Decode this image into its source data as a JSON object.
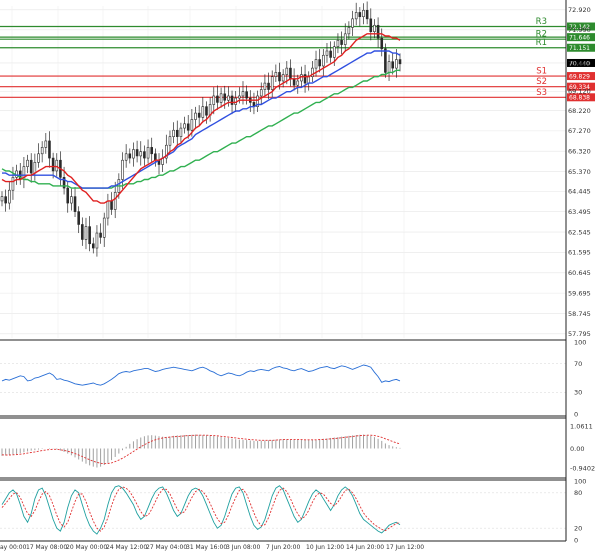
{
  "chart_data": [
    {
      "type": "candlestick",
      "ylim": [
        57.6,
        73.1
      ],
      "price_ticks": [
        "72.920",
        "71.990",
        "70.440",
        "69.120",
        "68.220",
        "67.270",
        "66.320",
        "65.370",
        "64.445",
        "63.495",
        "62.545",
        "61.595",
        "60.645",
        "59.695",
        "58.745",
        "57.795"
      ],
      "price_tick_values": [
        72.92,
        71.99,
        70.44,
        69.12,
        68.22,
        67.27,
        66.32,
        65.37,
        64.445,
        63.495,
        62.545,
        61.595,
        60.645,
        59.695,
        58.745,
        57.795
      ],
      "current_price": {
        "label": "70.440",
        "value": 70.44,
        "color": "#000000"
      },
      "levels": [
        {
          "name": "R3",
          "label": "72.142",
          "value": 72.142,
          "color": "#2e8b2e"
        },
        {
          "name": "",
          "label": "71.646",
          "value": 71.646,
          "color": "#2e8b2e"
        },
        {
          "name": "R2",
          "label": "",
          "value": 71.55,
          "color": "#2e8b2e"
        },
        {
          "name": "R1",
          "label": "71.151",
          "value": 71.151,
          "color": "#2e8b2e"
        },
        {
          "name": "S1",
          "label": "69.829",
          "value": 69.829,
          "color": "#e03030"
        },
        {
          "name": "S2",
          "label": "69.334",
          "value": 69.334,
          "color": "#e03030"
        },
        {
          "name": "S3",
          "label": "68.838",
          "value": 68.838,
          "color": "#e03030"
        }
      ],
      "ma_colors": {
        "fast": "#e02020",
        "mid": "#3050e0",
        "slow": "#30b050"
      },
      "candle_colors": {
        "body": "#2a2a2a",
        "wick": "#2a2a2a"
      },
      "grid": true,
      "closes": [
        64.2,
        63.9,
        64.5,
        65.1,
        65.4,
        65.0,
        65.6,
        65.9,
        65.3,
        65.8,
        66.2,
        66.5,
        66.8,
        66.0,
        65.4,
        65.9,
        65.1,
        64.6,
        63.9,
        64.2,
        63.5,
        62.9,
        62.2,
        62.8,
        62.0,
        61.8,
        62.5,
        62.3,
        63.2,
        64.0,
        63.6,
        64.4,
        65.0,
        65.9,
        66.2,
        66.0,
        66.4,
        66.1,
        66.3,
        66.0,
        66.5,
        66.2,
        65.9,
        65.7,
        66.0,
        66.6,
        67.0,
        67.3,
        67.0,
        67.4,
        67.6,
        67.3,
        67.8,
        68.1,
        67.9,
        68.4,
        68.0,
        68.5,
        68.9,
        68.6,
        69.0,
        68.7,
        68.9,
        68.5,
        68.8,
        68.9,
        69.1,
        68.8,
        68.6,
        68.4,
        68.9,
        69.2,
        69.5,
        69.2,
        69.8,
        70.0,
        69.6,
        69.9,
        70.2,
        69.7,
        69.4,
        69.6,
        69.9,
        69.5,
        69.8,
        70.2,
        70.6,
        70.3,
        70.8,
        71.0,
        70.7,
        71.2,
        71.5,
        71.3,
        71.8,
        72.1,
        72.5,
        72.8,
        72.6,
        72.9,
        72.5,
        71.9,
        72.2,
        71.6,
        71.1,
        70.0,
        70.5,
        70.2,
        70.6,
        70.4
      ],
      "ma_fast": [
        65.0,
        64.9,
        64.9,
        64.9,
        65.0,
        65.0,
        65.1,
        65.2,
        65.2,
        65.3,
        65.4,
        65.5,
        65.6,
        65.6,
        65.6,
        65.6,
        65.5,
        65.4,
        65.2,
        65.1,
        64.9,
        64.7,
        64.5,
        64.4,
        64.2,
        64.0,
        64.0,
        63.9,
        63.9,
        64.0,
        64.0,
        64.1,
        64.3,
        64.5,
        64.7,
        64.9,
        65.1,
        65.3,
        65.5,
        65.6,
        65.7,
        65.8,
        65.9,
        65.9,
        66.0,
        66.1,
        66.3,
        66.4,
        66.6,
        66.7,
        66.9,
        67.0,
        67.2,
        67.4,
        67.5,
        67.7,
        67.8,
        68.0,
        68.2,
        68.3,
        68.4,
        68.5,
        68.6,
        68.6,
        68.6,
        68.7,
        68.7,
        68.7,
        68.7,
        68.7,
        68.7,
        68.8,
        68.9,
        69.0,
        69.1,
        69.3,
        69.4,
        69.5,
        69.6,
        69.7,
        69.7,
        69.7,
        69.8,
        69.8,
        69.8,
        69.9,
        70.0,
        70.1,
        70.2,
        70.3,
        70.4,
        70.5,
        70.7,
        70.8,
        71.0,
        71.1,
        71.3,
        71.5,
        71.6,
        71.7,
        71.8,
        71.8,
        71.8,
        71.8,
        71.8,
        71.7,
        71.7,
        71.6,
        71.6,
        71.5
      ],
      "ma_mid": [
        65.3,
        65.3,
        65.2,
        65.2,
        65.2,
        65.2,
        65.2,
        65.2,
        65.2,
        65.2,
        65.2,
        65.2,
        65.2,
        65.2,
        65.2,
        65.1,
        65.0,
        65.0,
        64.9,
        64.9,
        64.8,
        64.7,
        64.6,
        64.6,
        64.6,
        64.6,
        64.6,
        64.6,
        64.6,
        64.6,
        64.7,
        64.7,
        64.8,
        64.9,
        65.0,
        65.1,
        65.2,
        65.3,
        65.4,
        65.5,
        65.6,
        65.7,
        65.8,
        65.9,
        66.0,
        66.1,
        66.2,
        66.3,
        66.5,
        66.6,
        66.7,
        66.8,
        66.9,
        67.1,
        67.2,
        67.3,
        67.4,
        67.5,
        67.6,
        67.7,
        67.8,
        67.9,
        68.0,
        68.1,
        68.2,
        68.2,
        68.3,
        68.3,
        68.4,
        68.4,
        68.5,
        68.5,
        68.6,
        68.7,
        68.8,
        68.8,
        68.9,
        69.0,
        69.1,
        69.1,
        69.2,
        69.3,
        69.3,
        69.4,
        69.5,
        69.5,
        69.6,
        69.7,
        69.8,
        69.8,
        69.9,
        70.0,
        70.1,
        70.2,
        70.3,
        70.4,
        70.5,
        70.6,
        70.7,
        70.8,
        70.9,
        70.9,
        71.0,
        71.0,
        71.0,
        71.0,
        71.0,
        70.9,
        70.9,
        70.8
      ],
      "ma_slow": [
        65.5,
        65.4,
        65.4,
        65.3,
        65.2,
        65.1,
        65.0,
        65.0,
        64.9,
        64.9,
        64.8,
        64.8,
        64.8,
        64.8,
        64.7,
        64.7,
        64.7,
        64.7,
        64.7,
        64.6,
        64.6,
        64.6,
        64.6,
        64.6,
        64.6,
        64.6,
        64.6,
        64.6,
        64.6,
        64.6,
        64.6,
        64.7,
        64.7,
        64.7,
        64.8,
        64.8,
        64.8,
        64.9,
        64.9,
        65.0,
        65.0,
        65.1,
        65.1,
        65.2,
        65.2,
        65.3,
        65.4,
        65.4,
        65.5,
        65.6,
        65.6,
        65.7,
        65.8,
        65.9,
        65.9,
        66.0,
        66.1,
        66.2,
        66.3,
        66.3,
        66.4,
        66.5,
        66.6,
        66.7,
        66.7,
        66.8,
        66.9,
        67.0,
        67.0,
        67.1,
        67.2,
        67.3,
        67.4,
        67.5,
        67.5,
        67.6,
        67.7,
        67.8,
        67.9,
        68.0,
        68.1,
        68.1,
        68.2,
        68.3,
        68.4,
        68.5,
        68.6,
        68.6,
        68.7,
        68.8,
        68.9,
        69.0,
        69.0,
        69.1,
        69.2,
        69.3,
        69.3,
        69.4,
        69.5,
        69.6,
        69.6,
        69.7,
        69.8,
        69.8,
        69.9,
        69.9,
        70.0,
        70.0,
        70.1,
        70.1
      ]
    },
    {
      "type": "line",
      "ylim": [
        0,
        100
      ],
      "ticks": [
        "100",
        "70",
        "30",
        "0"
      ],
      "tick_values": [
        100,
        70,
        30,
        0
      ],
      "series": [
        {
          "color": "#2a6fd6",
          "values": [
            46,
            48,
            47,
            49,
            51,
            53,
            52,
            46,
            47,
            50,
            51,
            53,
            55,
            57,
            54,
            48,
            49,
            47,
            46,
            44,
            42,
            41,
            40,
            41,
            42,
            43,
            41,
            40,
            42,
            45,
            48,
            52,
            56,
            58,
            59,
            58,
            60,
            61,
            62,
            63,
            63,
            61,
            59,
            60,
            62,
            63,
            64,
            65,
            64,
            63,
            62,
            61,
            60,
            62,
            64,
            65,
            63,
            60,
            58,
            55,
            53,
            55,
            57,
            56,
            54,
            53,
            55,
            58,
            60,
            59,
            61,
            62,
            61,
            60,
            63,
            65,
            66,
            64,
            63,
            61,
            60,
            62,
            63,
            61,
            59,
            60,
            62,
            64,
            65,
            66,
            64,
            63,
            65,
            67,
            66,
            64,
            62,
            64,
            66,
            68,
            67,
            65,
            58,
            52,
            44,
            46,
            45,
            47,
            48,
            46
          ]
        }
      ]
    },
    {
      "type": "bar",
      "ylim": [
        -1.35,
        1.35
      ],
      "ticks": [
        "1.0611",
        "0.00",
        "-0.9402"
      ],
      "tick_values": [
        1.0611,
        0,
        -0.9402
      ],
      "histogram_color": "#a0a0a0",
      "signal_color": "#e03030",
      "histogram": [
        -0.35,
        -0.33,
        -0.3,
        -0.28,
        -0.26,
        -0.22,
        -0.18,
        -0.14,
        -0.1,
        -0.08,
        -0.05,
        -0.02,
        0.0,
        0.02,
        0.01,
        -0.04,
        -0.1,
        -0.16,
        -0.24,
        -0.32,
        -0.42,
        -0.52,
        -0.62,
        -0.72,
        -0.8,
        -0.86,
        -0.9,
        -0.86,
        -0.78,
        -0.68,
        -0.55,
        -0.4,
        -0.24,
        -0.08,
        0.08,
        0.22,
        0.34,
        0.44,
        0.52,
        0.58,
        0.62,
        0.63,
        0.61,
        0.58,
        0.56,
        0.55,
        0.57,
        0.6,
        0.62,
        0.63,
        0.64,
        0.64,
        0.65,
        0.66,
        0.65,
        0.64,
        0.63,
        0.62,
        0.6,
        0.57,
        0.55,
        0.52,
        0.5,
        0.47,
        0.44,
        0.42,
        0.41,
        0.4,
        0.38,
        0.36,
        0.36,
        0.37,
        0.38,
        0.39,
        0.4,
        0.42,
        0.43,
        0.44,
        0.44,
        0.43,
        0.42,
        0.41,
        0.41,
        0.4,
        0.4,
        0.41,
        0.42,
        0.44,
        0.46,
        0.48,
        0.5,
        0.52,
        0.54,
        0.56,
        0.58,
        0.6,
        0.62,
        0.64,
        0.65,
        0.66,
        0.64,
        0.6,
        0.54,
        0.46,
        0.36,
        0.24,
        0.16,
        0.1,
        0.06,
        0.03
      ],
      "signal": [
        -0.3,
        -0.31,
        -0.31,
        -0.3,
        -0.29,
        -0.27,
        -0.25,
        -0.22,
        -0.19,
        -0.16,
        -0.13,
        -0.1,
        -0.07,
        -0.05,
        -0.04,
        -0.04,
        -0.06,
        -0.09,
        -0.13,
        -0.18,
        -0.24,
        -0.31,
        -0.38,
        -0.46,
        -0.53,
        -0.6,
        -0.66,
        -0.7,
        -0.72,
        -0.71,
        -0.68,
        -0.62,
        -0.55,
        -0.46,
        -0.36,
        -0.25,
        -0.14,
        -0.03,
        0.08,
        0.18,
        0.27,
        0.35,
        0.41,
        0.46,
        0.5,
        0.52,
        0.54,
        0.56,
        0.57,
        0.58,
        0.6,
        0.61,
        0.62,
        0.63,
        0.63,
        0.63,
        0.63,
        0.62,
        0.61,
        0.6,
        0.58,
        0.56,
        0.54,
        0.52,
        0.5,
        0.48,
        0.46,
        0.44,
        0.42,
        0.41,
        0.4,
        0.39,
        0.39,
        0.39,
        0.39,
        0.4,
        0.41,
        0.42,
        0.42,
        0.42,
        0.42,
        0.42,
        0.42,
        0.41,
        0.41,
        0.41,
        0.41,
        0.42,
        0.43,
        0.44,
        0.46,
        0.47,
        0.49,
        0.51,
        0.53,
        0.55,
        0.57,
        0.59,
        0.61,
        0.62,
        0.63,
        0.63,
        0.61,
        0.58,
        0.53,
        0.46,
        0.4,
        0.33,
        0.27,
        0.22
      ]
    },
    {
      "type": "line",
      "ylim": [
        0,
        100
      ],
      "ticks": [
        "100",
        "80",
        "20",
        "0"
      ],
      "tick_values": [
        100,
        80,
        20,
        0
      ],
      "series": [
        {
          "color": "#20a0a0",
          "values": [
            60,
            70,
            80,
            85,
            78,
            60,
            40,
            30,
            45,
            70,
            85,
            88,
            75,
            55,
            35,
            20,
            15,
            30,
            55,
            75,
            85,
            80,
            60,
            40,
            25,
            15,
            10,
            20,
            35,
            60,
            80,
            90,
            92,
            88,
            80,
            70,
            60,
            45,
            35,
            40,
            55,
            70,
            82,
            88,
            90,
            80,
            65,
            50,
            40,
            45,
            60,
            75,
            85,
            88,
            85,
            75,
            60,
            45,
            30,
            20,
            25,
            40,
            60,
            78,
            88,
            90,
            80,
            60,
            40,
            25,
            18,
            22,
            35,
            55,
            75,
            88,
            92,
            85,
            70,
            55,
            40,
            30,
            35,
            50,
            65,
            78,
            85,
            80,
            70,
            60,
            50,
            60,
            75,
            85,
            90,
            85,
            75,
            60,
            45,
            35,
            30,
            25,
            20,
            15,
            12,
            18,
            25,
            28,
            30,
            26
          ]
        },
        {
          "color": "#e03030",
          "values": [
            55,
            62,
            70,
            78,
            80,
            72,
            58,
            45,
            40,
            50,
            65,
            78,
            82,
            75,
            60,
            42,
            28,
            22,
            30,
            48,
            65,
            78,
            78,
            65,
            48,
            32,
            20,
            15,
            22,
            38,
            58,
            75,
            86,
            90,
            88,
            82,
            72,
            60,
            48,
            40,
            42,
            52,
            65,
            78,
            86,
            86,
            78,
            65,
            52,
            45,
            48,
            60,
            72,
            82,
            86,
            82,
            74,
            62,
            48,
            36,
            28,
            30,
            42,
            58,
            72,
            84,
            86,
            78,
            62,
            46,
            32,
            24,
            26,
            38,
            55,
            72,
            84,
            88,
            82,
            70,
            56,
            44,
            36,
            40,
            50,
            64,
            75,
            80,
            78,
            70,
            62,
            58,
            64,
            74,
            84,
            86,
            80,
            70,
            58,
            46,
            38,
            32,
            26,
            22,
            18,
            16,
            20,
            24,
            28,
            30
          ]
        }
      ]
    }
  ],
  "x_axis_labels": [
    "ay 00:00",
    "17 May 08:00",
    "20 May 00:00",
    "24 May 12:00",
    "27 May 04:00",
    "31 May 16:00",
    "3 Jun 08:00",
    "7 Jun 20:00",
    "10 Jun 12:00",
    "14 Jun 20:00",
    "17 Jun 12:00"
  ]
}
